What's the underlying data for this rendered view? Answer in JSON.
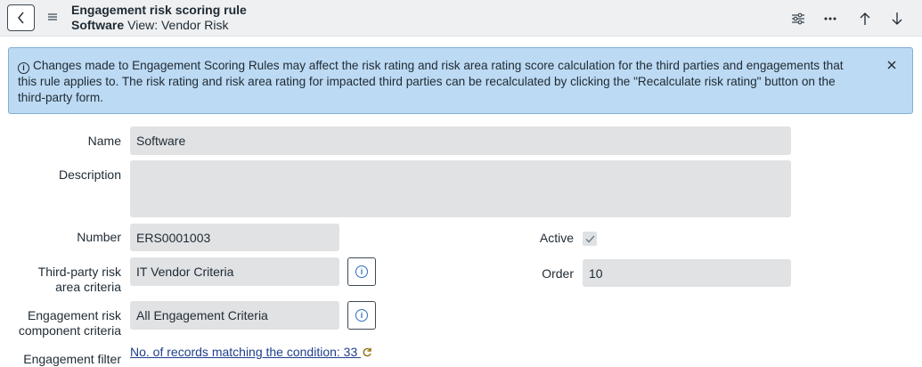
{
  "header": {
    "table_title": "Engagement risk scoring rule",
    "record_name": "Software",
    "view_label": "View: Vendor Risk"
  },
  "banner": {
    "message": "Changes made to Engagement Scoring Rules may affect the risk rating and risk area rating score calculation for the third parties and engagements that this rule applies to. The risk rating and risk area rating for impacted third parties can be recalculated by clicking the \"Recalculate risk rating\" button on the third-party form."
  },
  "form": {
    "name_label": "Name",
    "name_value": "Software",
    "description_label": "Description",
    "description_value": "",
    "number_label": "Number",
    "number_value": "ERS0001003",
    "tp_risk_label_line1": "Third-party risk",
    "tp_risk_label_line2": "area criteria",
    "tp_risk_value": "IT Vendor Criteria",
    "eng_risk_label_line1": "Engagement risk",
    "eng_risk_label_line2": "component criteria",
    "eng_risk_value": "All Engagement Criteria",
    "eng_filter_label": "Engagement filter",
    "eng_filter_link": "No. of records matching the condition: 33",
    "active_label": "Active",
    "active_checked": true,
    "order_label": "Order",
    "order_value": "10"
  },
  "icons": {
    "back": "chevron-left-icon",
    "menu": "hamburger-icon",
    "personalize": "sliders-icon",
    "more": "more-options-icon",
    "prev": "arrow-up-icon",
    "next": "arrow-down-icon",
    "close": "close-icon",
    "info": "info-icon",
    "refresh": "refresh-icon"
  },
  "colors": {
    "banner_bg": "#bcdaf3",
    "link": "#1f3e8c",
    "info_accent": "#2a6ebd"
  }
}
